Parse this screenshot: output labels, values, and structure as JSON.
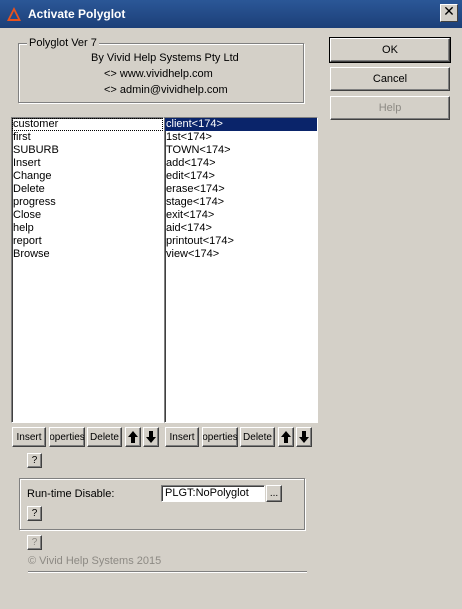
{
  "window": {
    "title": "Activate Polyglot",
    "close_glyph": "✕",
    "app_icon": "polyglot-logo-icon"
  },
  "info": {
    "legend": "Polyglot Ver 7",
    "company": "By Vivid Help Systems Pty Ltd",
    "website": "<>  www.vividhelp.com",
    "email": "<>  admin@vividhelp.com"
  },
  "actions": {
    "ok": "OK",
    "cancel": "Cancel",
    "help": "Help"
  },
  "left_list": {
    "items": [
      "customer",
      "first",
      "SUBURB",
      "Insert",
      "Change",
      "Delete",
      "progress",
      "Close",
      "help",
      "report",
      "Browse"
    ],
    "selected_index": 0
  },
  "right_list": {
    "items": [
      "client<174>",
      "1st<174>",
      "TOWN<174>",
      "add<174>",
      "edit<174>",
      "erase<174>",
      "stage<174>",
      "exit<174>",
      "aid<174>",
      "printout<174>",
      "view<174>"
    ],
    "selected_index": 0
  },
  "list_buttons": {
    "insert": "Insert",
    "properties": "operties",
    "delete": "Delete",
    "up_icon": "arrow-up-icon",
    "down_icon": "arrow-down-icon"
  },
  "question_label": "?",
  "runtime": {
    "label": "Run-time Disable:",
    "value": "PLGT:NoPolyglot",
    "browse_label": "..."
  },
  "footer": {
    "copyright": "© Vivid Help Systems 2015"
  },
  "colors": {
    "title_bar": "#1f4a8a",
    "face": "#d4d0c8",
    "selection": "#0a246a"
  }
}
